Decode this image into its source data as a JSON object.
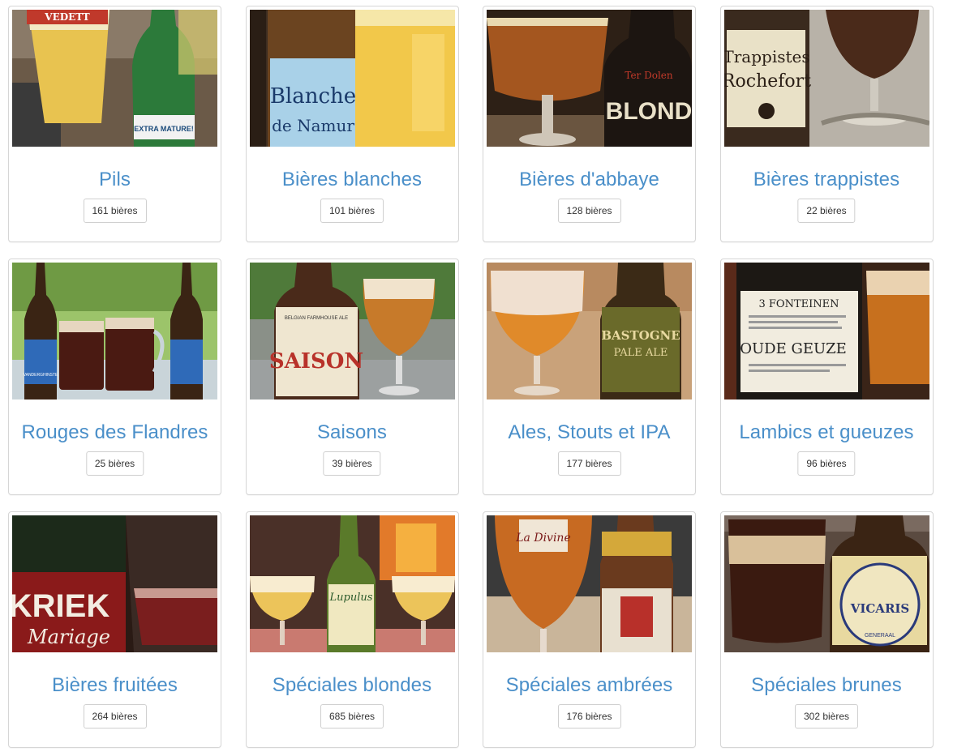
{
  "categories": [
    {
      "title": "Pils",
      "count": "161 bières",
      "label_text": "VEDETT",
      "label_text2": "EXTRA MATURE!"
    },
    {
      "title": "Bières blanches",
      "count": "101 bières",
      "label_text": "Blanche",
      "label_text2": "de Namur"
    },
    {
      "title": "Bières d'abbaye",
      "count": "128 bières",
      "label_text": "Ter Dolen",
      "label_text2": "BLOND"
    },
    {
      "title": "Bières trappistes",
      "count": "22 bières",
      "label_text": "Trappistes",
      "label_text2": "Rochefort"
    },
    {
      "title": "Rouges des Flandres",
      "count": "25 bières",
      "label_text": "VANDERGHINSTE",
      "label_text2": ""
    },
    {
      "title": "Saisons",
      "count": "39 bières",
      "label_text": "SAISON",
      "label_text2": "BELGIAN FARMHOUSE ALE"
    },
    {
      "title": "Ales, Stouts et IPA",
      "count": "177 bières",
      "label_text": "BASTOGNE",
      "label_text2": "PALE ALE"
    },
    {
      "title": "Lambics et gueuzes",
      "count": "96 bières",
      "label_text": "3 FONTEINEN",
      "label_text2": "OUDE GEUZE"
    },
    {
      "title": "Bières fruitées",
      "count": "264 bières",
      "label_text": "KRIEK",
      "label_text2": "Mariage"
    },
    {
      "title": "Spéciales blondes",
      "count": "685 bières",
      "label_text": "Lupulus",
      "label_text2": ""
    },
    {
      "title": "Spéciales ambrées",
      "count": "176 bières",
      "label_text": "La Divine",
      "label_text2": ""
    },
    {
      "title": "Spéciales brunes",
      "count": "302 bières",
      "label_text": "VICARIS",
      "label_text2": "GENERAAL"
    }
  ],
  "colors": {
    "link": "#4a8fc9",
    "card_border": "#d6d6d6",
    "button_border": "#cfcfcf"
  }
}
